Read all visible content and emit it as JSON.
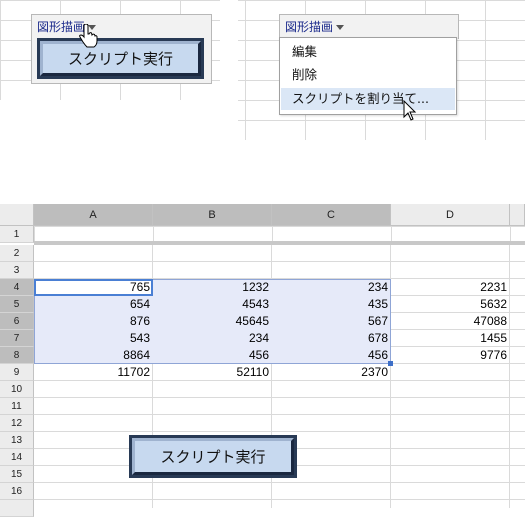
{
  "drawing_menu_label": "図形描画",
  "script_button_label": "スクリプト実行",
  "context_menu": {
    "items": [
      "編集",
      "削除",
      "スクリプトを割り当て..."
    ]
  },
  "sheet": {
    "columns": [
      "A",
      "B",
      "C",
      "D"
    ],
    "rows": [
      "1",
      "2",
      "3",
      "4",
      "5",
      "6",
      "7",
      "8",
      "9",
      "10",
      "11",
      "12",
      "13",
      "14",
      "15",
      "16"
    ],
    "cells": {
      "r4": [
        "765",
        "1232",
        "234",
        "2231"
      ],
      "r5": [
        "654",
        "4543",
        "435",
        "5632"
      ],
      "r6": [
        "876",
        "45645",
        "567",
        "47088"
      ],
      "r7": [
        "543",
        "234",
        "678",
        "1455"
      ],
      "r8": [
        "8864",
        "456",
        "456",
        "9776"
      ],
      "r9": [
        "11702",
        "52110",
        "2370",
        ""
      ]
    },
    "selected_range": "A4:C8"
  },
  "colors": {
    "button_face": "#c7d9ef",
    "button_border": "#283a55",
    "selection_fill": "#e6eaf9",
    "selection_border": "#3d6fc8",
    "menu_highlight": "#dbe7f6",
    "menu_label_color": "#1c2b8c"
  },
  "icons": [
    "hand-pointer-cursor",
    "arrow-cursor",
    "dropdown-caret"
  ]
}
